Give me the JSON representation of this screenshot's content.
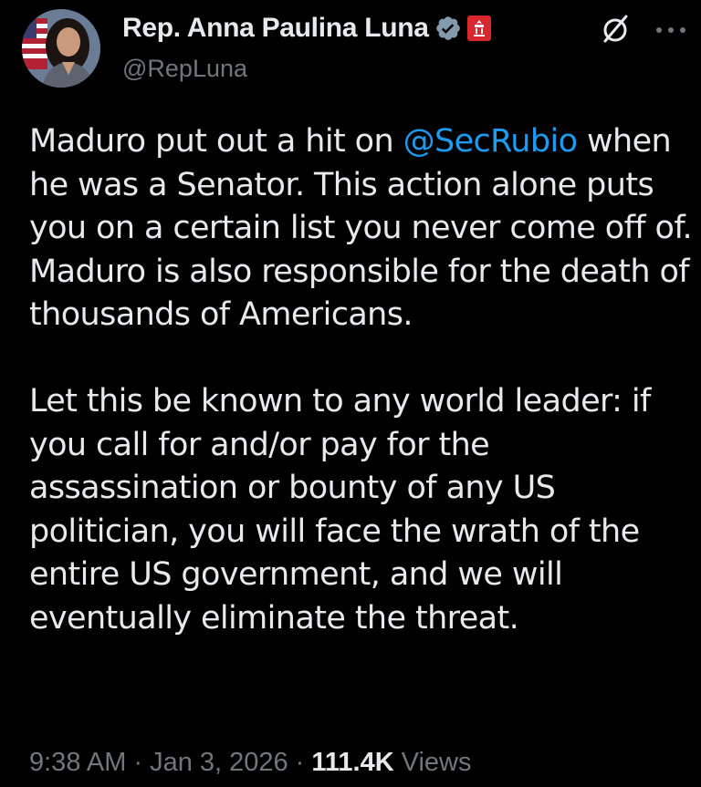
{
  "author": {
    "display_name": "Rep. Anna Paulina Luna",
    "handle": "@RepLuna"
  },
  "icons": {
    "verified": "verified-badge-icon",
    "government": "government-badge-icon",
    "grok": "grok-icon",
    "more": "more-options-icon"
  },
  "colors": {
    "background": "#000000",
    "text": "#e7e9ea",
    "secondary": "#71767b",
    "link": "#1d9bf0",
    "gov_badge": "#d8272d"
  },
  "tweet": {
    "paragraph1_before": "Maduro put out a hit on ",
    "mention": "@SecRubio",
    "paragraph1_after": " when he was a Senator. This action alone puts you on a certain list you never come off of.  Maduro is also responsible for the death of thousands of Americans.",
    "paragraph2": "Let this be known to any world leader: if you call for and/or pay for the assassination or bounty of any US politician, you will face the wrath of the entire US government, and we will eventually eliminate the threat."
  },
  "meta": {
    "time": "9:38 AM",
    "separator": "·",
    "date": "Jan 3, 2026",
    "views_count": "111.4K",
    "views_label": "Views"
  }
}
